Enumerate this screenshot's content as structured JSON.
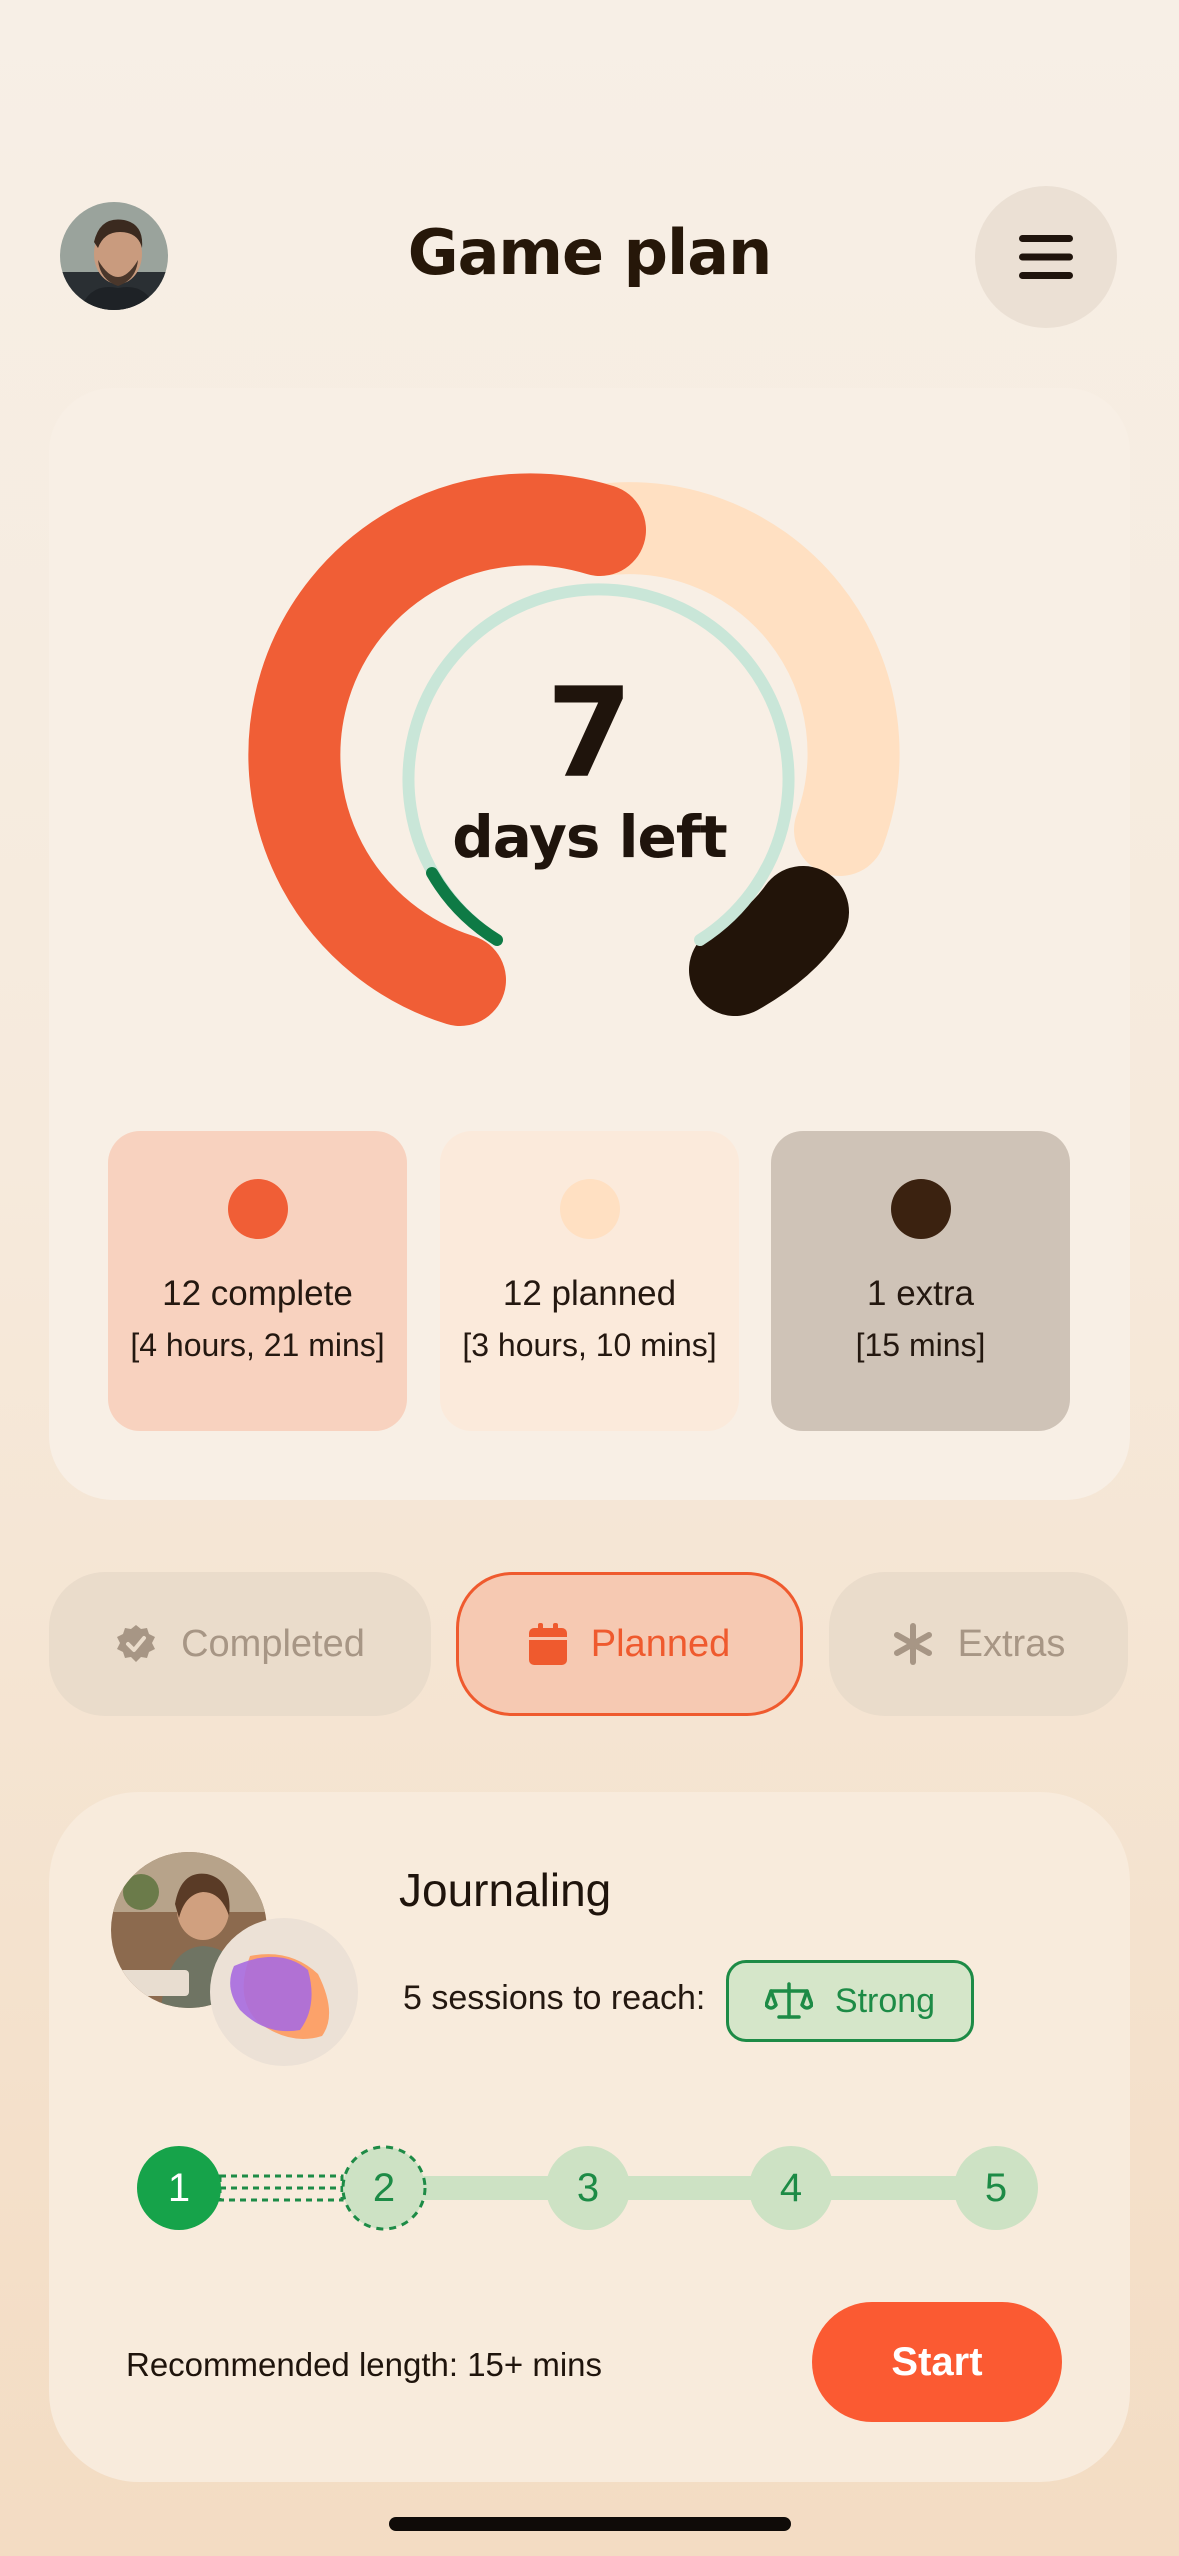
{
  "header": {
    "title": "Game plan",
    "menu_icon": "hamburger-menu-icon",
    "avatar": "user-avatar"
  },
  "summary": {
    "days_number": "7",
    "days_label": "days left",
    "ring": {
      "complete": 12,
      "planned": 12,
      "extra": 1,
      "colors": {
        "complete": "#f05e36",
        "planned": "#ffe0c2",
        "extra": "#221409",
        "track": "#c9e6d8",
        "progress": "#0e7a45"
      }
    },
    "stats": [
      {
        "title": "12 complete",
        "subtitle": "[4 hours, 21 mins]",
        "dot_color": "#f05e36",
        "bg": "#f8d2bf"
      },
      {
        "title": "12 planned",
        "subtitle": "[3 hours, 10 mins]",
        "dot_color": "#ffe0c2",
        "bg": "#fbeadb"
      },
      {
        "title": "1 extra",
        "subtitle": "[15 mins]",
        "dot_color": "#3b2210",
        "bg": "#cfc3b7"
      }
    ]
  },
  "tabs": [
    {
      "label": "Completed",
      "icon": "check-badge-icon",
      "selected": false
    },
    {
      "label": "Planned",
      "icon": "calendar-icon",
      "selected": true
    },
    {
      "label": "Extras",
      "icon": "asterisk-icon",
      "selected": false
    }
  ],
  "activity": {
    "title": "Journaling",
    "sessions_text": "5 sessions to reach:",
    "badge": {
      "label": "Strong",
      "icon": "scale-icon"
    },
    "steps": [
      "1",
      "2",
      "3",
      "4",
      "5"
    ],
    "current_step": 1,
    "recommended": "Recommended length: 15+ mins",
    "start_label": "Start"
  }
}
